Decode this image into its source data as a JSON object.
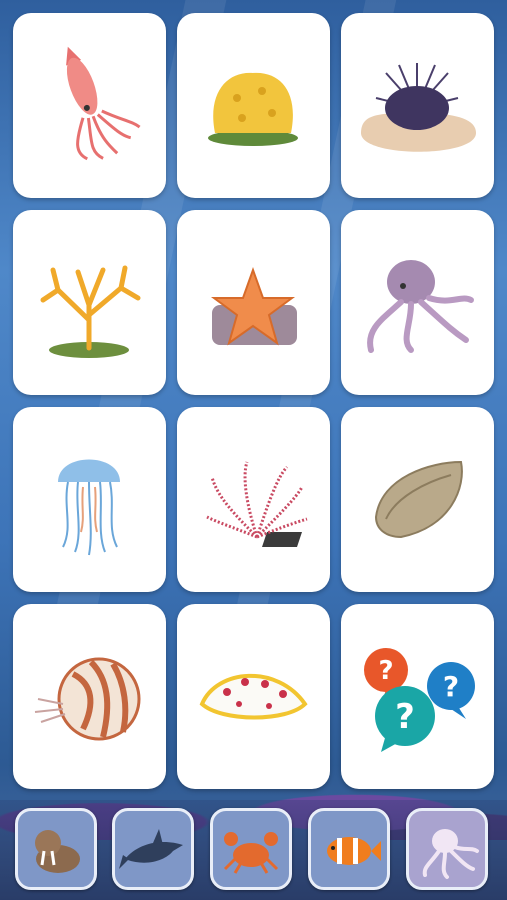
{
  "cards": [
    {
      "name": "squid",
      "icon": "squid-icon"
    },
    {
      "name": "sea-sponge",
      "icon": "sponge-icon"
    },
    {
      "name": "sea-urchin",
      "icon": "urchin-icon"
    },
    {
      "name": "coral",
      "icon": "coral-icon"
    },
    {
      "name": "starfish",
      "icon": "starfish-icon"
    },
    {
      "name": "octopus",
      "icon": "octopus-icon"
    },
    {
      "name": "jellyfish",
      "icon": "jellyfish-icon"
    },
    {
      "name": "feather-star",
      "icon": "crinoid-icon"
    },
    {
      "name": "oyster",
      "icon": "oyster-icon"
    },
    {
      "name": "nautilus",
      "icon": "nautilus-icon"
    },
    {
      "name": "sea-slug",
      "icon": "nudibranch-icon"
    },
    {
      "name": "mystery",
      "icon": "question-bubbles-icon"
    }
  ],
  "categories": [
    {
      "name": "walrus",
      "icon": "walrus-icon",
      "active": false
    },
    {
      "name": "shark",
      "icon": "shark-icon",
      "active": false
    },
    {
      "name": "crab",
      "icon": "crab-icon",
      "active": false
    },
    {
      "name": "clownfish",
      "icon": "clownfish-icon",
      "active": false
    },
    {
      "name": "octopus",
      "icon": "octopus-icon",
      "active": true
    }
  ],
  "colors": {
    "bubble_red": "#e8572a",
    "bubble_blue": "#1f7fc7",
    "bubble_teal": "#1aa6a6",
    "card_bg": "#ffffff"
  }
}
